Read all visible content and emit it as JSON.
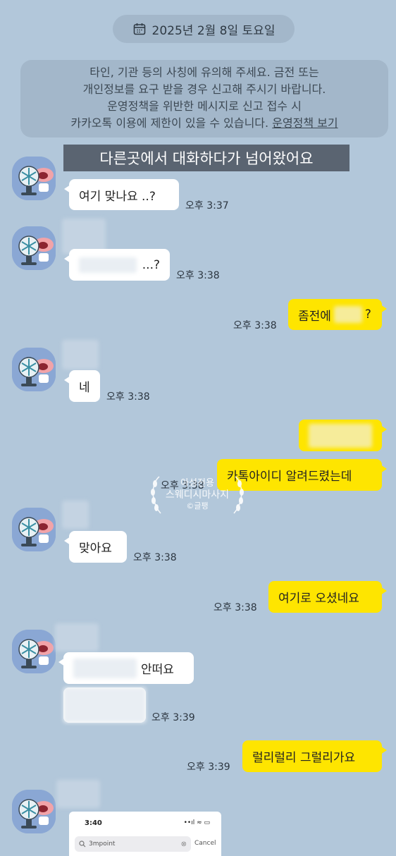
{
  "date_divider": {
    "label": "2025년 2월 8일 토요일",
    "icon": "calendar-icon"
  },
  "notice": {
    "line1": "타인, 기관 등의 사칭에 유의해 주세요. 금전 또는",
    "line2": "개인정보를 요구 받을 경우 신고해 주시기 바랍니다.",
    "line3": "운영정책을 위반한 메시지로 신고 접수 시",
    "line4": "카카오톡 이용에 제한이 있을 수 있습니다.",
    "link": "운영정책 보기"
  },
  "caption": "다른곳에서 대화하다가 넘어왔어요",
  "messages": [
    {
      "side": "in",
      "text": "여기 맞나요 ..?",
      "time": "오후 3:37"
    },
    {
      "side": "in",
      "text": "...?",
      "time": "오후 3:38"
    },
    {
      "side": "out",
      "text": "좀전에",
      "suffix": "?",
      "time": "오후 3:38"
    },
    {
      "side": "in",
      "text": "네",
      "time": "오후 3:38"
    },
    {
      "side": "out",
      "text": "카톡아이디 알려드렸는데",
      "time": "오후 3:38"
    },
    {
      "side": "in",
      "text": "맞아요",
      "time": "오후 3:38"
    },
    {
      "side": "out",
      "text": "여기로 오셨네요",
      "time": "오후 3:38"
    },
    {
      "side": "in",
      "text": "안떠요",
      "time": "오후 3:39"
    },
    {
      "side": "out",
      "text": "럴리럴리 그럴리가요",
      "time": "오후 3:39"
    }
  ],
  "watermark": {
    "line1": "아성전용",
    "line2": "스웨디시마사지",
    "line3": "©글팽"
  },
  "screenshot": {
    "clock": "3:40",
    "status_icons": "••ıl ≈ ▭",
    "search_value": "3mpoint",
    "cancel": "Cancel"
  },
  "colors": {
    "background": "#b2c7da",
    "outgoing": "#fee500",
    "incoming": "#ffffff"
  }
}
